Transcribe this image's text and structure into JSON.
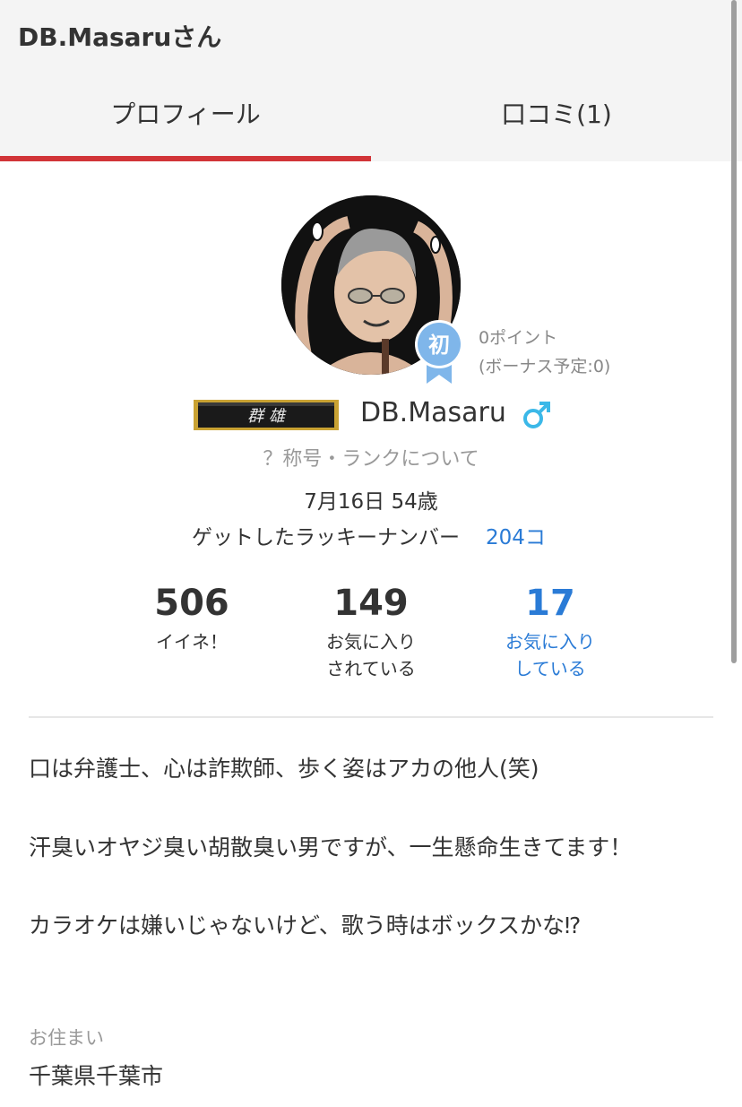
{
  "header": {
    "title": "DB.Masaruさん",
    "tabs": [
      {
        "label": "プロフィール",
        "active": true
      },
      {
        "label": "口コミ(1)",
        "active": false
      }
    ]
  },
  "profile": {
    "badge_text": "初",
    "points": "0ポイント",
    "bonus": "(ボーナス予定:0)",
    "rank_title": "群 雄",
    "username": "DB.Masaru",
    "gender_symbol": "♂",
    "rank_info_link": "？称号・ランクについて",
    "birth_age": "7月16日 54歳",
    "lucky_label": "ゲットしたラッキーナンバー",
    "lucky_count": "204コ"
  },
  "stats": [
    {
      "value": "506",
      "label": "イイネ！"
    },
    {
      "value": "149",
      "label": "お気に入り\nされている"
    },
    {
      "value": "17",
      "label": "お気に入り\nしている"
    }
  ],
  "intro": [
    "口は弁護士、心は詐欺師、歩く姿はアカの他人(笑)",
    "汗臭いオヤジ臭い胡散臭い男ですが、一生懸命生きてます！",
    "カラオケは嫌いじゃないけど、歌う時はボックスかな⁉"
  ],
  "residence": {
    "label": "お住まい",
    "value": "千葉県千葉市"
  },
  "colors": {
    "accent_red": "#d13438",
    "link_blue": "#2a7bd6",
    "badge_blue": "#7fb6ea",
    "gender_blue": "#3bb8e8"
  }
}
